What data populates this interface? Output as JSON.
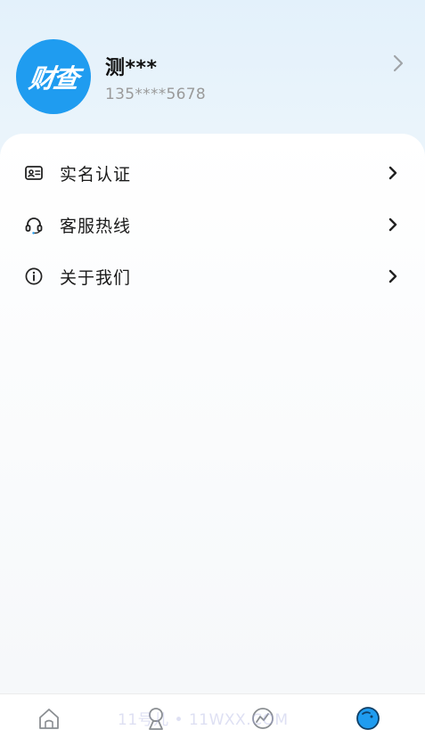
{
  "profile": {
    "avatar_text": "财查",
    "name": "测***",
    "phone": "135****5678"
  },
  "menu": {
    "items": [
      {
        "label": "实名认证",
        "icon": "id-card-icon"
      },
      {
        "label": "客服热线",
        "icon": "headset-icon"
      },
      {
        "label": "关于我们",
        "icon": "info-icon"
      }
    ]
  },
  "tabbar": {
    "tabs": [
      {
        "icon": "home-icon",
        "active": false
      },
      {
        "icon": "pedestal-icon",
        "active": false
      },
      {
        "icon": "chart-icon",
        "active": false
      },
      {
        "icon": "profile-icon",
        "active": true
      }
    ],
    "watermark": "11号儿 • 11WXX.COM"
  },
  "colors": {
    "accent": "#1f9cf0",
    "text_primary": "#111111",
    "text_secondary": "#9a9a9a"
  }
}
